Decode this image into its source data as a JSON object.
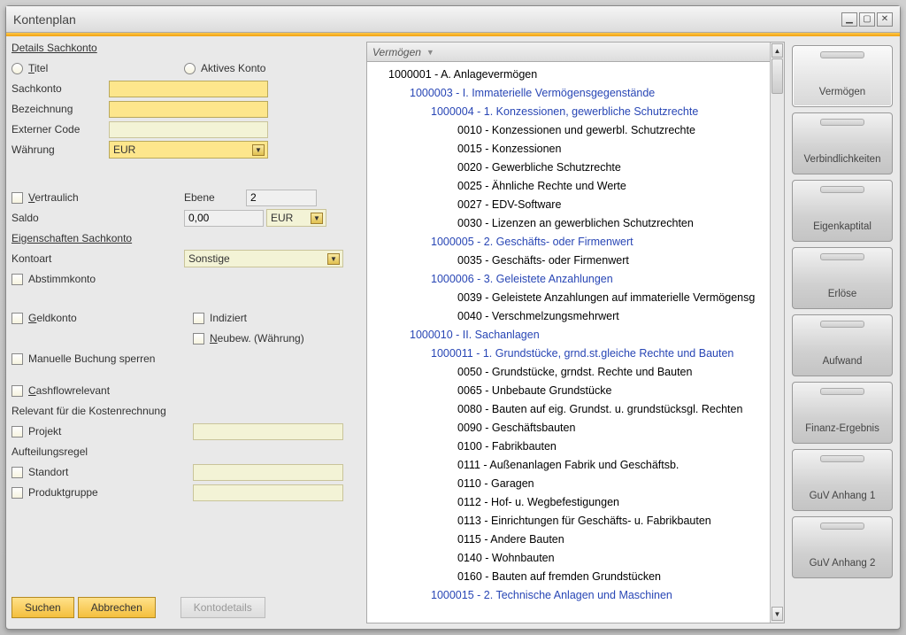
{
  "window": {
    "title": "Kontenplan"
  },
  "left": {
    "section_details": "Details Sachkonto",
    "radio_titel": "Titel",
    "radio_aktiv": "Aktives Konto",
    "lbl_sachkonto": "Sachkonto",
    "lbl_bezeichnung": "Bezeichnung",
    "lbl_externer": "Externer Code",
    "lbl_waehrung": "Währung",
    "val_waehrung": "EUR",
    "chk_vertraulich": "Vertraulich",
    "lbl_ebene": "Ebene",
    "val_ebene": "2",
    "lbl_saldo": "Saldo",
    "val_saldo": "0,00",
    "val_saldo_cur": "EUR",
    "section_eigenschaften": "Eigenschaften Sachkonto",
    "lbl_kontoart": "Kontoart",
    "val_kontoart": "Sonstige",
    "chk_abstimm": "Abstimmkonto",
    "chk_geld": "Geldkonto",
    "chk_indiziert": "Indiziert",
    "chk_neubew": "Neubew. (Währung)",
    "chk_manuell": "Manuelle Buchung sperren",
    "chk_cashflow": "Cashflowrelevant",
    "lbl_relevant": "Relevant für die Kostenrechnung",
    "chk_projekt": "Projekt",
    "lbl_aufteilung": "Aufteilungsregel",
    "chk_standort": "Standort",
    "chk_produkt": "Produktgruppe",
    "btn_suchen": "Suchen",
    "btn_abbrechen": "Abbrechen",
    "btn_kontodetails": "Kontodetails"
  },
  "tree": {
    "header": "Vermögen",
    "nodes": [
      {
        "lvl": 1,
        "grp": false,
        "t": "1000001 - A. Anlagevermögen"
      },
      {
        "lvl": 2,
        "grp": true,
        "t": "1000003 - I. Immaterielle Vermögensgegenstände"
      },
      {
        "lvl": 3,
        "grp": true,
        "t": "1000004 - 1. Konzessionen, gewerbliche Schutzrechte"
      },
      {
        "lvl": 4,
        "grp": false,
        "t": "0010 - Konzessionen und gewerbl. Schutzrechte"
      },
      {
        "lvl": 4,
        "grp": false,
        "t": "0015 - Konzessionen"
      },
      {
        "lvl": 4,
        "grp": false,
        "t": "0020 - Gewerbliche Schutzrechte"
      },
      {
        "lvl": 4,
        "grp": false,
        "t": "0025 - Ähnliche Rechte und Werte"
      },
      {
        "lvl": 4,
        "grp": false,
        "t": "0027 - EDV-Software"
      },
      {
        "lvl": 4,
        "grp": false,
        "t": "0030 - Lizenzen an gewerblichen Schutzrechten"
      },
      {
        "lvl": 3,
        "grp": true,
        "t": "1000005 - 2. Geschäfts- oder Firmenwert"
      },
      {
        "lvl": 4,
        "grp": false,
        "t": "0035 - Geschäfts- oder Firmenwert"
      },
      {
        "lvl": 3,
        "grp": true,
        "t": "1000006 - 3. Geleistete Anzahlungen"
      },
      {
        "lvl": 4,
        "grp": false,
        "t": "0039 - Geleistete Anzahlungen auf immaterielle Vermögensg"
      },
      {
        "lvl": 4,
        "grp": false,
        "t": "0040 - Verschmelzungsmehrwert"
      },
      {
        "lvl": 2,
        "grp": true,
        "t": "1000010 - II. Sachanlagen"
      },
      {
        "lvl": 3,
        "grp": true,
        "t": "1000011 - 1. Grundstücke, grnd.st.gleiche Rechte und Bauten"
      },
      {
        "lvl": 4,
        "grp": false,
        "t": "0050 - Grundstücke, grndst. Rechte und Bauten"
      },
      {
        "lvl": 4,
        "grp": false,
        "t": "0065 - Unbebaute Grundstücke"
      },
      {
        "lvl": 4,
        "grp": false,
        "t": "0080 - Bauten auf eig. Grundst. u. grundstücksgl. Rechten"
      },
      {
        "lvl": 4,
        "grp": false,
        "t": "0090 - Geschäftsbauten"
      },
      {
        "lvl": 4,
        "grp": false,
        "t": "0100 - Fabrikbauten"
      },
      {
        "lvl": 4,
        "grp": false,
        "t": "0111 - Außenanlagen Fabrik und Geschäftsb."
      },
      {
        "lvl": 4,
        "grp": false,
        "t": "0110 - Garagen"
      },
      {
        "lvl": 4,
        "grp": false,
        "t": "0112 - Hof- u. Wegbefestigungen"
      },
      {
        "lvl": 4,
        "grp": false,
        "t": "0113 - Einrichtungen für Geschäfts- u. Fabrikbauten"
      },
      {
        "lvl": 4,
        "grp": false,
        "t": "0115 - Andere Bauten"
      },
      {
        "lvl": 4,
        "grp": false,
        "t": "0140 - Wohnbauten"
      },
      {
        "lvl": 4,
        "grp": false,
        "t": "0160 - Bauten auf fremden Grundstücken"
      },
      {
        "lvl": 3,
        "grp": true,
        "t": "1000015 - 2. Technische Anlagen und Maschinen"
      }
    ]
  },
  "tabs": [
    "Vermögen",
    "Verbindlichkeiten",
    "Eigenkaptital",
    "Erlöse",
    "Aufwand",
    "Finanz-Ergebnis",
    "GuV Anhang 1",
    "GuV Anhang 2"
  ]
}
